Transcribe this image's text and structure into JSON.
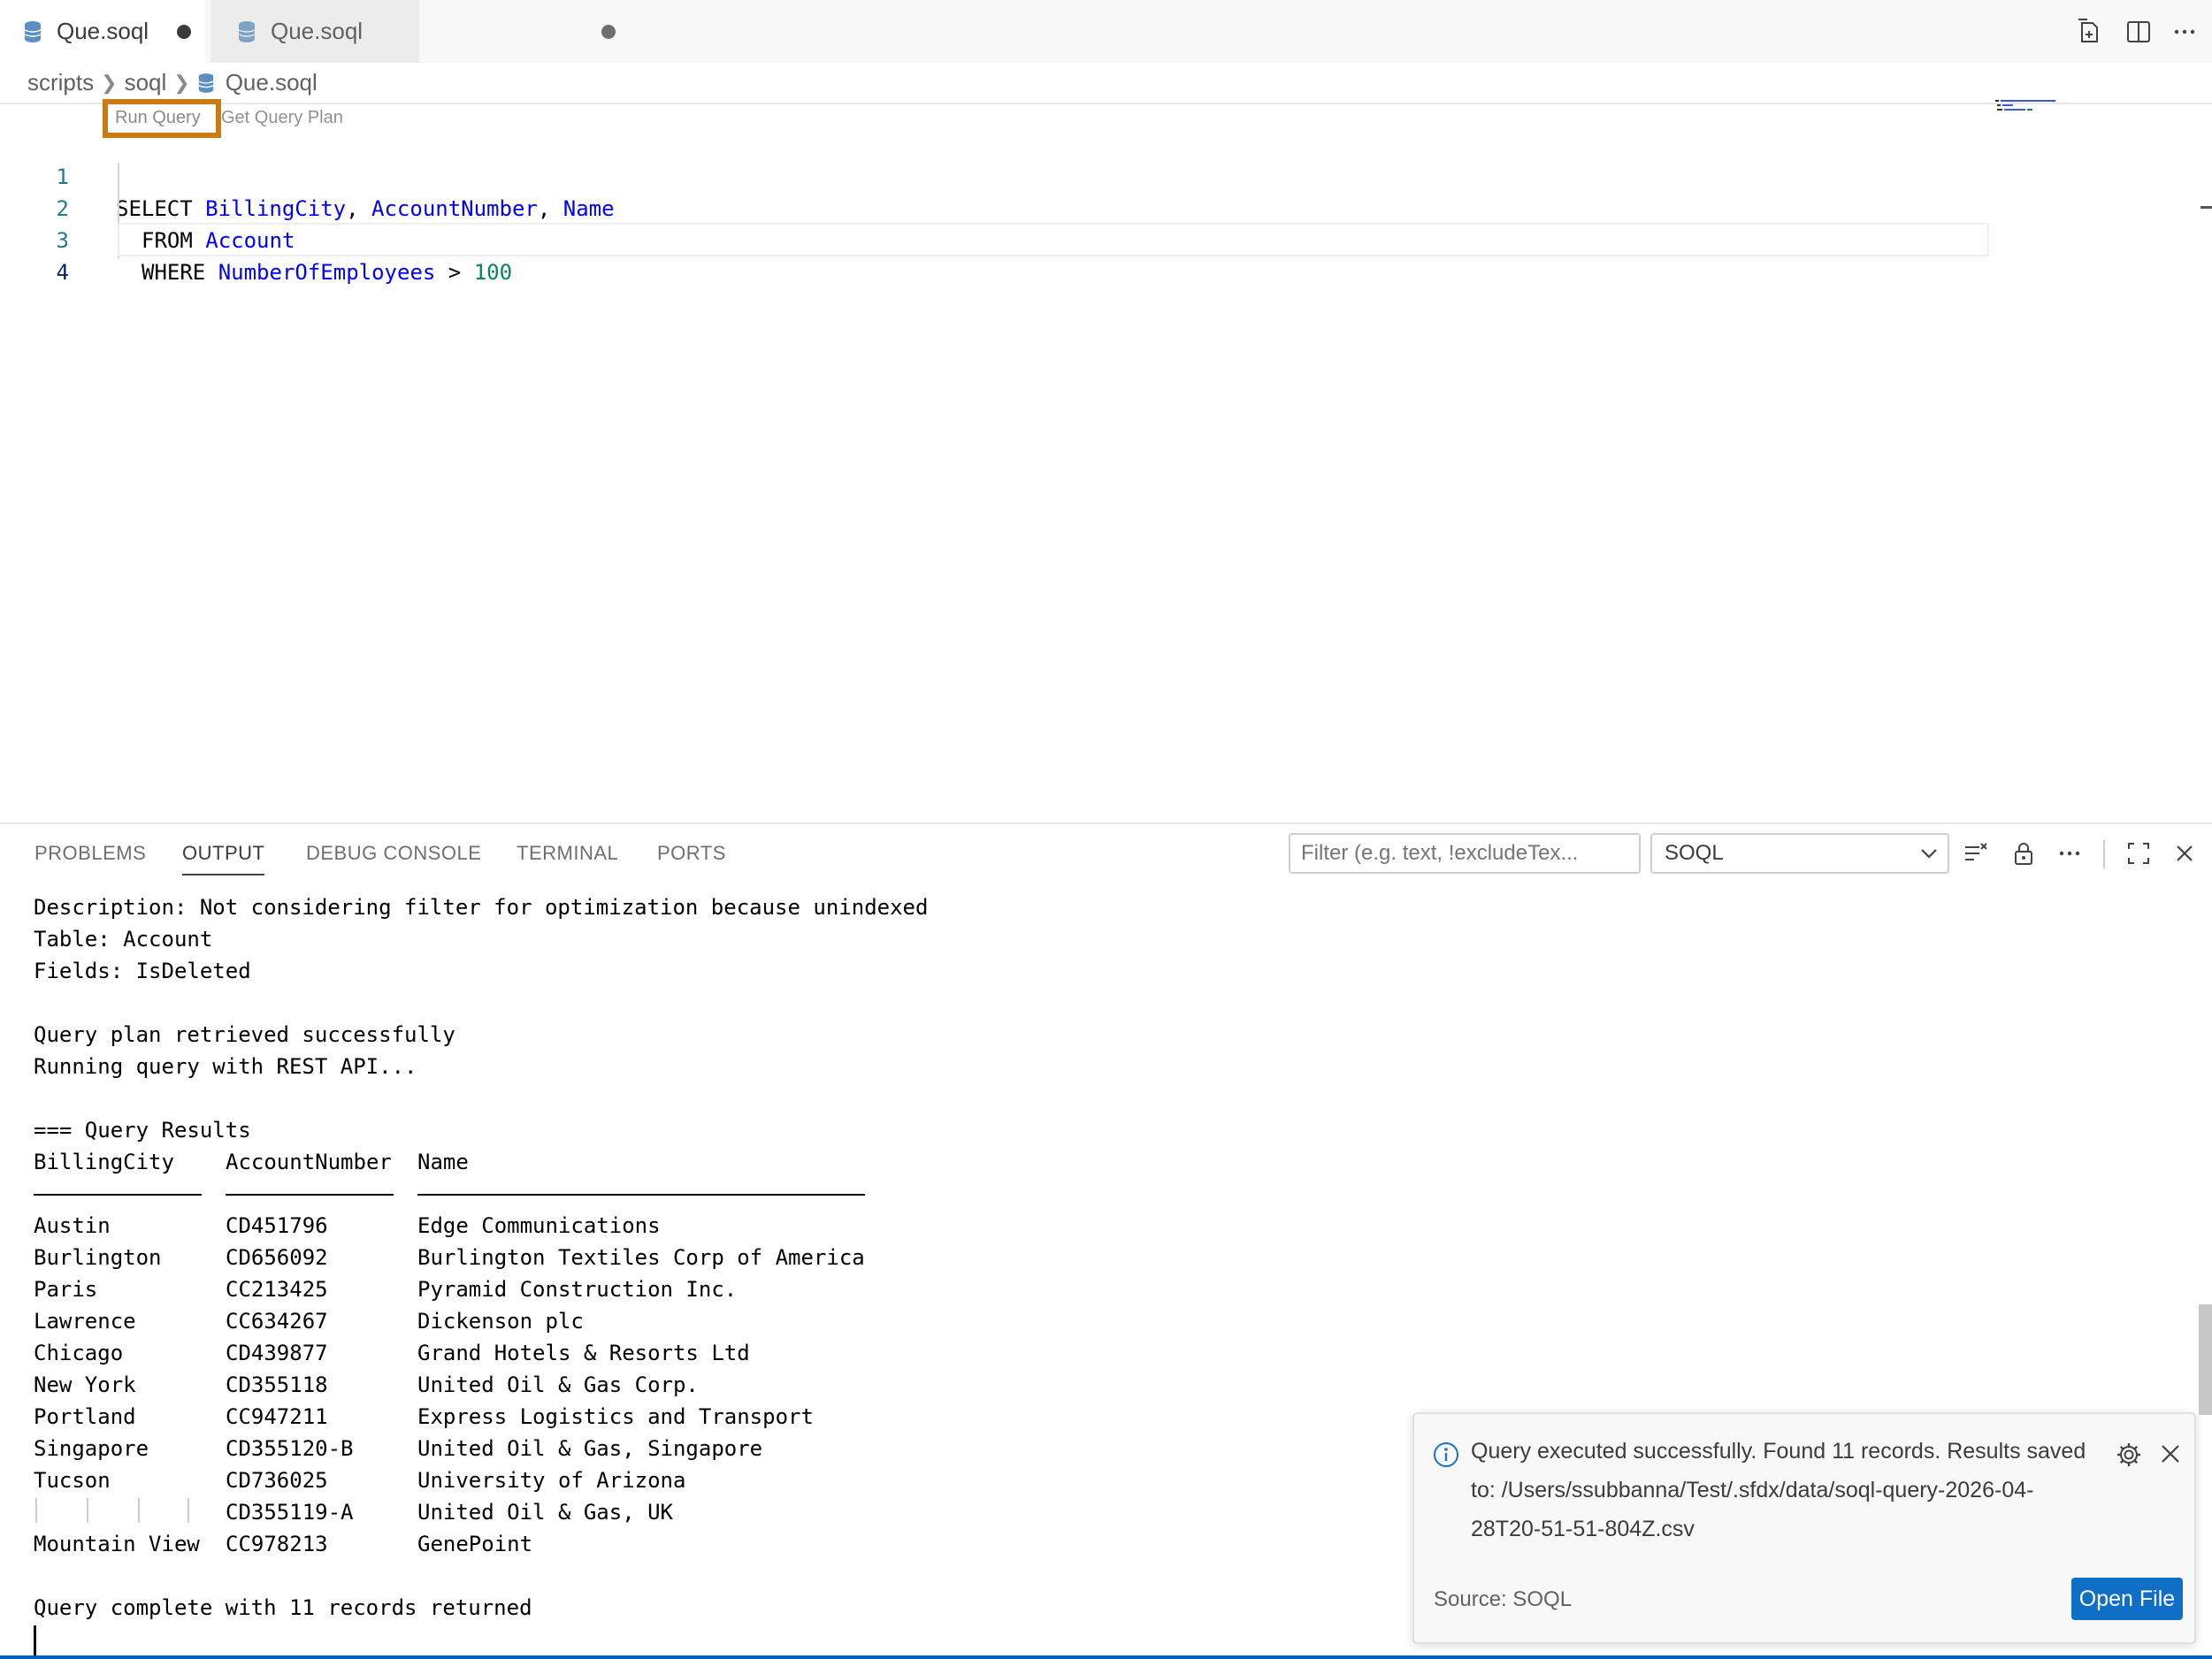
{
  "tabs": [
    {
      "label": "Que.soql"
    },
    {
      "label": "Que.soql"
    }
  ],
  "breadcrumb": {
    "parts": [
      "scripts",
      "soql",
      "Que.soql"
    ]
  },
  "codelens": {
    "run": "Run Query",
    "plan": "Get Query Plan"
  },
  "editor": {
    "line_numbers": [
      "1",
      "2",
      "3",
      "4"
    ],
    "lines": [
      {
        "kw1": "SELECT ",
        "f1": "BillingCity",
        "c1": ", ",
        "f2": "AccountNumber",
        "c2": ", ",
        "f3": "Name"
      },
      {
        "kw": "FROM ",
        "obj": "Account"
      },
      {
        "kw": "WHERE ",
        "field": "NumberOfEmployees",
        "op": " > ",
        "num": "100"
      }
    ]
  },
  "panel": {
    "tabs": [
      "PROBLEMS",
      "OUTPUT",
      "DEBUG CONSOLE",
      "TERMINAL",
      "PORTS"
    ],
    "active_tab": "OUTPUT",
    "filter_placeholder": "Filter (e.g. text, !excludeTex...",
    "channel": "SOQL"
  },
  "output": {
    "pre_lines": [
      "Description: Not considering filter for optimization because unindexed",
      "Table: Account",
      "Fields: IsDeleted",
      "",
      "Query plan retrieved successfully",
      "Running query with REST API...",
      "",
      "=== Query Results"
    ],
    "headers": [
      "BillingCity",
      "AccountNumber",
      "Name"
    ],
    "rows": [
      [
        "Austin",
        "CD451796",
        "Edge Communications"
      ],
      [
        "Burlington",
        "CD656092",
        "Burlington Textiles Corp of America"
      ],
      [
        "Paris",
        "CC213425",
        "Pyramid Construction Inc."
      ],
      [
        "Lawrence",
        "CC634267",
        "Dickenson plc"
      ],
      [
        "Chicago",
        "CD439877",
        "Grand Hotels & Resorts Ltd"
      ],
      [
        "New York",
        "CD355118",
        "United Oil & Gas Corp."
      ],
      [
        "Portland",
        "CC947211",
        "Express Logistics and Transport"
      ],
      [
        "Singapore",
        "CD355120-B",
        "United Oil & Gas, Singapore"
      ],
      [
        "Tucson",
        "CD736025",
        "University of Arizona"
      ],
      [
        "",
        "CD355119-A",
        "United Oil & Gas, UK"
      ],
      [
        "Mountain View",
        "CC978213",
        "GenePoint"
      ]
    ],
    "complete": "Query complete with 11 records returned"
  },
  "notification": {
    "message": "Query executed successfully. Found 11 records. Results saved to: /Users/ssubbanna/Test/.sfdx/data/soql-query-2026-04-28T20-51-51-804Z.csv",
    "source": "Source: SOQL",
    "button": "Open File"
  },
  "colors": {
    "accent": "#0f6fc6",
    "highlight": "#cc7a14",
    "keyword_id": "#0000ff",
    "number": "#098658",
    "line_number": "#237893"
  }
}
